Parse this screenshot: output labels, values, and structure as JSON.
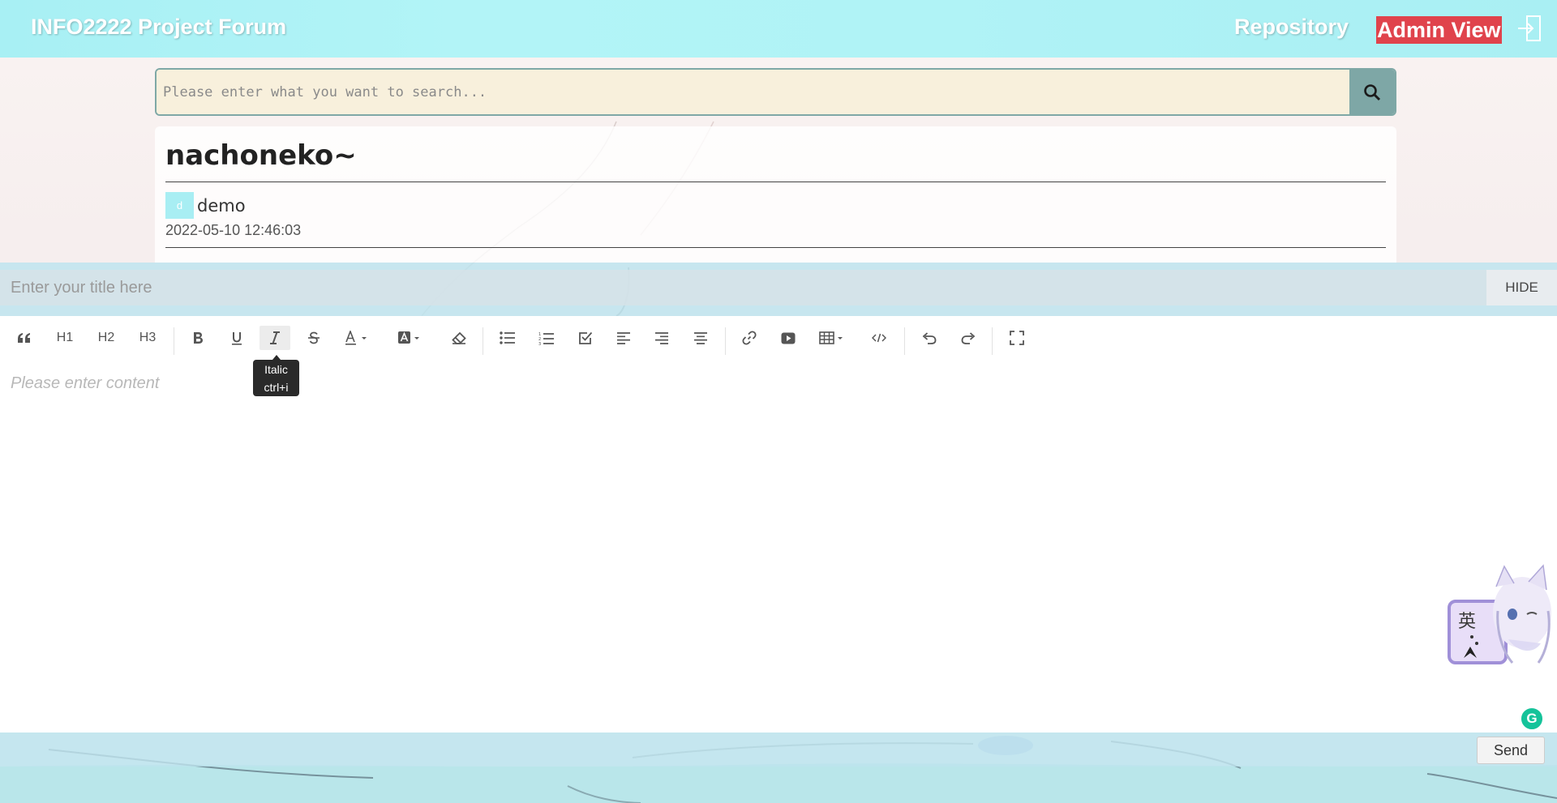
{
  "header": {
    "brand": "INFO2222 Project Forum",
    "nav_repository": "Repository",
    "nav_admin": "Admin View"
  },
  "search": {
    "placeholder": "Please enter what you want to search...",
    "value": ""
  },
  "post": {
    "title": "nachoneko~",
    "avatar_letter": "d",
    "author": "demo",
    "date": "2022-05-10 12:46:03"
  },
  "editor": {
    "title_placeholder": "Enter your title here",
    "hide_label": "HIDE",
    "content_placeholder": "Please enter content",
    "toolbar": {
      "h1": "H1",
      "h2": "H2",
      "h3": "H3",
      "tooltip_title": "Italic",
      "tooltip_shortcut": "ctrl+i"
    },
    "send_label": "Send"
  },
  "widgets": {
    "mascot_glyph": "英",
    "grammarly_letter": "G"
  },
  "colors": {
    "header": "#b0f3f6",
    "admin_badge": "#e0434c",
    "search_bg": "#f8f0dc",
    "search_button": "#7ea7a6",
    "avatar": "#a8eef3"
  }
}
